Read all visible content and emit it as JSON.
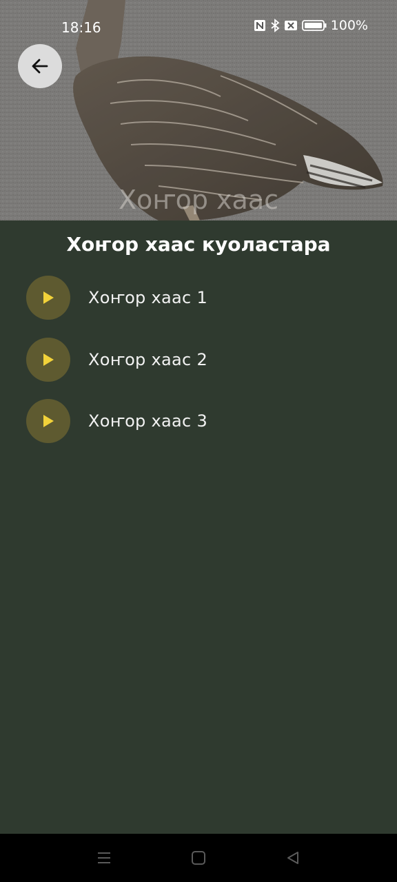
{
  "status_bar": {
    "time": "18:16",
    "battery_percent": "100%",
    "icons": [
      "nfc-icon",
      "bluetooth-icon",
      "sim-off-icon",
      "battery-icon"
    ]
  },
  "hero": {
    "title": "Хоҥор хаас",
    "image": "goose-photo"
  },
  "header": {
    "back_icon": "arrow-left-icon"
  },
  "content": {
    "title": "Хоҥор хаас куоластара",
    "tracks": [
      {
        "label": "Хоҥор хаас 1"
      },
      {
        "label": "Хоҥор хаас 2"
      },
      {
        "label": "Хоҥор хаас 3"
      }
    ]
  },
  "nav_bar": {
    "buttons": [
      "menu-icon",
      "home-icon",
      "back-triangle-icon"
    ]
  },
  "colors": {
    "background": "#2f3a2f",
    "play_button_bg": "#5e5a30",
    "play_icon": "#f2d23a",
    "back_button_bg": "#dcdcdc"
  }
}
